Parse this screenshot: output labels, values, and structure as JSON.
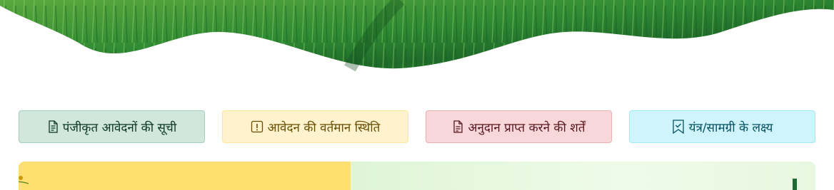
{
  "hero": {
    "image_description_icon": "wheat-field-banner",
    "colors": {
      "field_dark": "#1f6b2a",
      "field_light": "#6fbf4a"
    }
  },
  "quick_links": [
    {
      "label": "पंजीकृत आवेदनों की सूची",
      "icon": "file-text-icon"
    },
    {
      "label": "आवेदन की वर्तमान स्थिति",
      "icon": "exclamation-square-icon"
    },
    {
      "label": "अनुदान प्राप्त करने की शर्तें",
      "icon": "file-earmark-text-icon"
    },
    {
      "label": "यंत्र/सामग्री के लक्ष्य",
      "icon": "bookmark-check-icon"
    }
  ],
  "content_panel": {
    "colors": {
      "left": "#ffdf6f",
      "right": "#e4f6dc"
    }
  }
}
